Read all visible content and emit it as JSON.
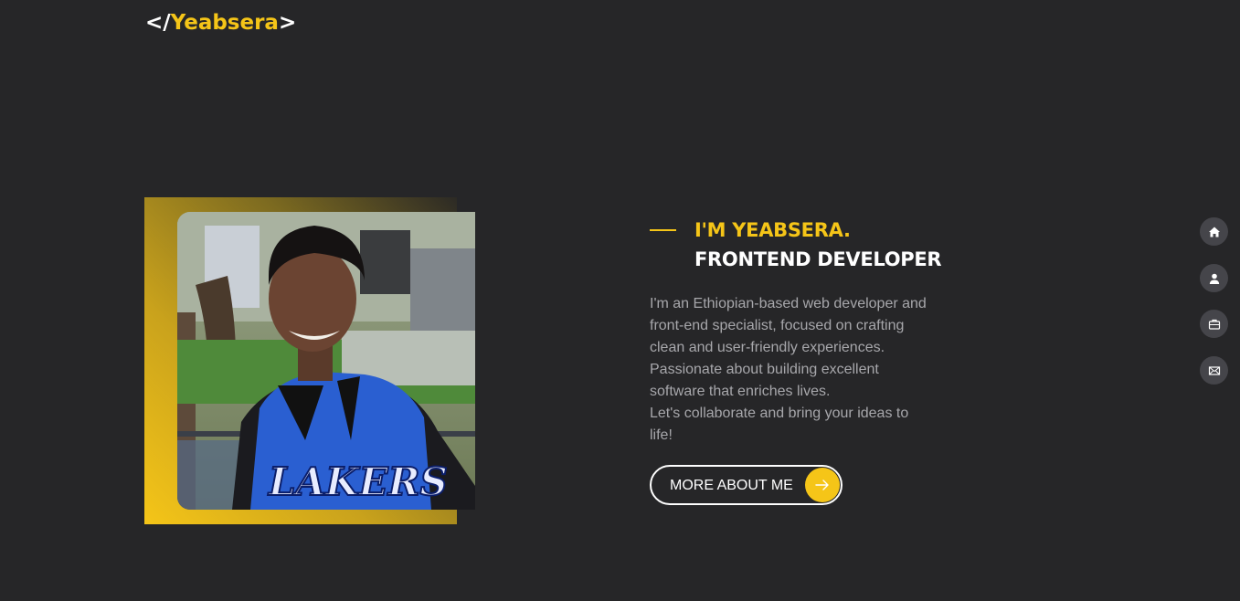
{
  "header": {
    "logo_open": "</",
    "logo_name": "Yeabsera",
    "logo_close": ">"
  },
  "intro": {
    "name_line": "I'M YEABSERA.",
    "role_line": "FRONTEND DEVELOPER"
  },
  "bio": {
    "lines": [
      "I'm an Ethiopian-based web developer and",
      "front-end specialist, focused on crafting",
      "clean and user-friendly experiences.",
      "Passionate about building excellent",
      "software that enriches lives.",
      "Let's collaborate and bring your ideas to",
      "life!"
    ]
  },
  "cta": {
    "label": "MORE ABOUT ME",
    "icon": "arrow-right-icon"
  },
  "side_nav": {
    "items": [
      {
        "icon": "home-icon"
      },
      {
        "icon": "user-icon"
      },
      {
        "icon": "briefcase-icon"
      },
      {
        "icon": "mail-icon"
      }
    ]
  },
  "colors": {
    "background": "#262628",
    "accent": "#f5c518",
    "text": "#ffffff",
    "muted": "#a7a7ab",
    "nav_bg": "#45454a"
  }
}
